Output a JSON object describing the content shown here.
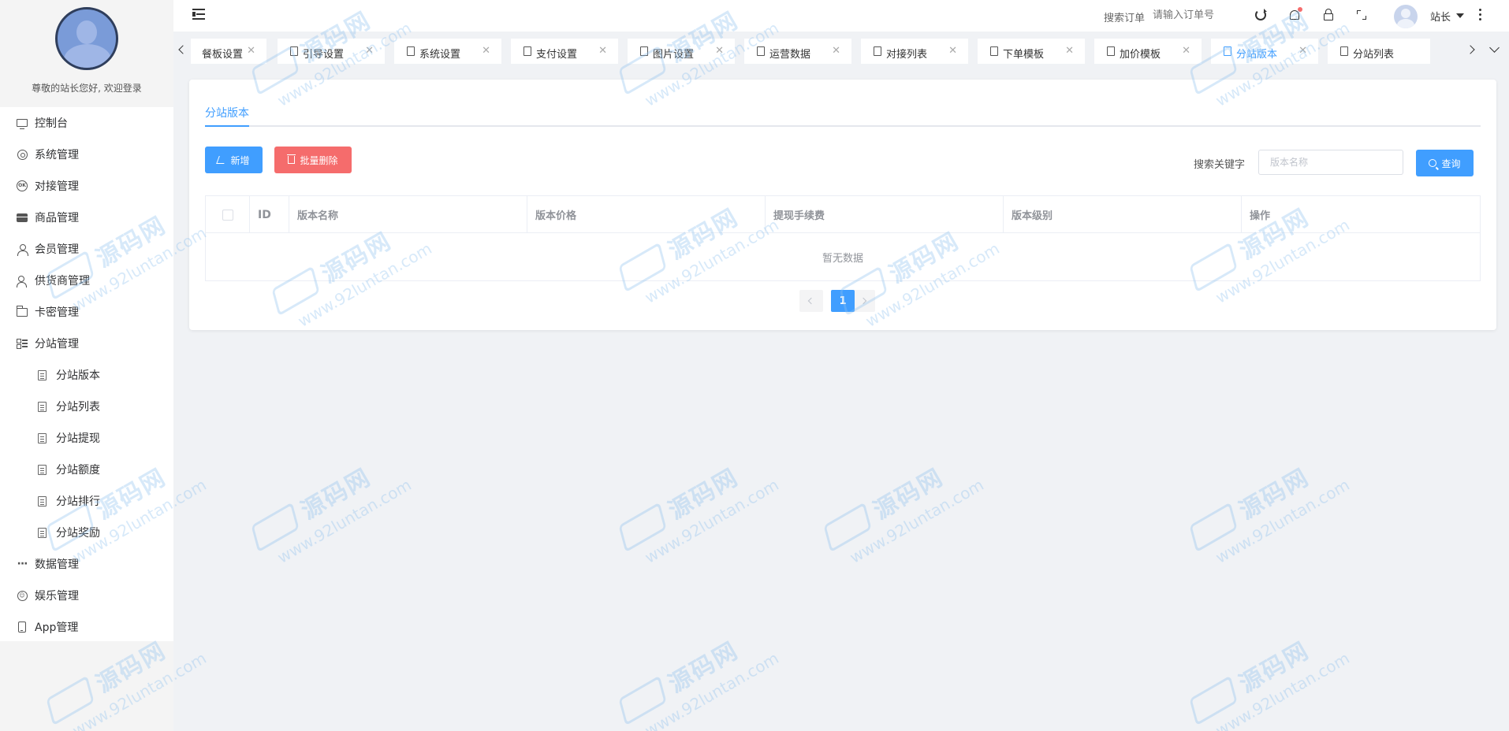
{
  "sidebar": {
    "welcome": "尊敬的站长您好, 欢迎登录",
    "items": [
      {
        "label": "控制台",
        "icon": "monitor-icon"
      },
      {
        "label": "系统管理",
        "icon": "gear-icon"
      },
      {
        "label": "对接管理",
        "icon": "ok-icon"
      },
      {
        "label": "商品管理",
        "icon": "store-icon"
      },
      {
        "label": "会员管理",
        "icon": "user-icon"
      },
      {
        "label": "供货商管理",
        "icon": "users-icon"
      },
      {
        "label": "卡密管理",
        "icon": "card-icon"
      },
      {
        "label": "分站管理",
        "icon": "list-icon"
      },
      {
        "label": "数据管理",
        "icon": "dots-icon"
      },
      {
        "label": "娱乐管理",
        "icon": "game-icon"
      },
      {
        "label": "App管理",
        "icon": "phone-icon"
      }
    ],
    "sub_items": [
      {
        "label": "分站版本",
        "icon": "document-icon"
      },
      {
        "label": "分站列表",
        "icon": "document-icon"
      },
      {
        "label": "分站提现",
        "icon": "document-icon"
      },
      {
        "label": "分站额度",
        "icon": "document-icon"
      },
      {
        "label": "分站排行",
        "icon": "document-icon"
      },
      {
        "label": "分站奖励",
        "icon": "document-icon"
      }
    ]
  },
  "header": {
    "search_label": "搜索订单",
    "search_placeholder": "请输入订单号",
    "user_name": "站长"
  },
  "tabs": [
    {
      "label": "餐板设置"
    },
    {
      "label": "引导设置"
    },
    {
      "label": "系统设置"
    },
    {
      "label": "支付设置"
    },
    {
      "label": "图片设置"
    },
    {
      "label": "运营数据"
    },
    {
      "label": "对接列表"
    },
    {
      "label": "下单模板"
    },
    {
      "label": "加价模板"
    },
    {
      "label": "分站版本",
      "active": true
    },
    {
      "label": "分站列表"
    }
  ],
  "main": {
    "inner_tab": "分站版本",
    "add_label": "新增",
    "batch_delete_label": "批量删除",
    "keyword_label": "搜索关键字",
    "keyword_placeholder": "版本名称",
    "search_button": "查询",
    "columns": [
      "ID",
      "版本名称",
      "版本价格",
      "提现手续费",
      "版本级别",
      "操作"
    ],
    "empty_text": "暂无数据",
    "current_page": "1"
  },
  "watermark": {
    "cn": "源码网",
    "url": "www.92luntan.com"
  },
  "colors": {
    "primary": "#409eff",
    "danger": "#f56c6c",
    "sidebar_bg": "#ffffff"
  }
}
